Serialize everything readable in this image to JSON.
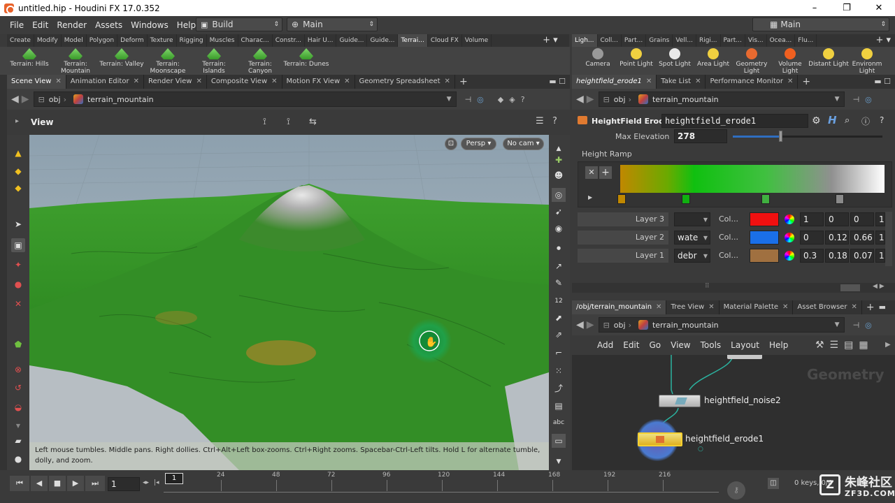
{
  "title": "untitled.hip - Houdini FX 17.0.352",
  "window_controls": [
    "–",
    "❐",
    "✕"
  ],
  "menu": [
    "File",
    "Edit",
    "Render",
    "Assets",
    "Windows",
    "Help"
  ],
  "desktop": {
    "build": "Build",
    "main": "Main",
    "main_right": "Main"
  },
  "shelf_tabs_left": [
    "Create",
    "Modify",
    "Model",
    "Polygon",
    "Deform",
    "Texture",
    "Rigging",
    "Muscles",
    "Charac...",
    "Constr...",
    "Hair U...",
    "Guide...",
    "Guide...",
    "Terrai...",
    "Cloud FX",
    "Volume"
  ],
  "shelf_tabs_right": [
    "Ligh...",
    "Coll...",
    "Part...",
    "Grains",
    "Vell...",
    "Rigi...",
    "Part...",
    "Vis...",
    "Ocea...",
    "Flu..."
  ],
  "terrain_tools": [
    {
      "l1": "Terrain: Hills",
      "l2": ""
    },
    {
      "l1": "Terrain:",
      "l2": "Mountain"
    },
    {
      "l1": "Terrain: Valley",
      "l2": ""
    },
    {
      "l1": "Terrain:",
      "l2": "Moonscape"
    },
    {
      "l1": "Terrain:",
      "l2": "Islands"
    },
    {
      "l1": "Terrain:",
      "l2": "Canyon"
    },
    {
      "l1": "Terrain: Dunes",
      "l2": ""
    }
  ],
  "light_tools": [
    {
      "l1": "Camera",
      "l2": ""
    },
    {
      "l1": "Point Light",
      "l2": ""
    },
    {
      "l1": "Spot Light",
      "l2": ""
    },
    {
      "l1": "Area Light",
      "l2": ""
    },
    {
      "l1": "Geometry",
      "l2": "Light"
    },
    {
      "l1": "Volume Light",
      "l2": ""
    },
    {
      "l1": "Distant Light",
      "l2": ""
    },
    {
      "l1": "Environm",
      "l2": "Light"
    }
  ],
  "viewer_tabs": [
    "Scene View",
    "Animation Editor",
    "Render View",
    "Composite View",
    "Motion FX View",
    "Geometry Spreadsheet"
  ],
  "path": {
    "root": "obj",
    "node": "terrain_mountain"
  },
  "viewer": {
    "label": "View",
    "persp": "Persp ▾",
    "cam": "No cam ▾",
    "hint": "Left mouse tumbles. Middle pans. Right dollies. Ctrl+Alt+Left box-zooms. Ctrl+Right zooms. Spacebar-Ctrl-Left tilts. Hold L for alternate tumble, dolly, and zoom."
  },
  "param_tabs": [
    "heightfield_erode1",
    "Take List",
    "Performance Monitor"
  ],
  "params": {
    "node_type": "HeightField Erode",
    "node_name": "heightfield_erode1",
    "max_elevation_label": "Max Elevation",
    "max_elevation": "278",
    "max_elevation_fraction": 0.32,
    "height_ramp_label": "Height Ramp",
    "layers": [
      {
        "label": "Layer 3",
        "name": "",
        "col": "Col...",
        "color": "#f01010",
        "r": "1",
        "g": "0",
        "b": "0",
        "a": "1"
      },
      {
        "label": "Layer 2",
        "name": "wate",
        "col": "Col...",
        "color": "#1a6fe8",
        "r": "0",
        "g": "0.12",
        "b": "0.66",
        "a": "1"
      },
      {
        "label": "Layer 1",
        "name": "debr",
        "col": "Col...",
        "color": "#a07040",
        "r": "0.3",
        "g": "0.18",
        "b": "0.07",
        "a": "1"
      }
    ]
  },
  "network_tabs": [
    "/obj/terrain_mountain",
    "Tree View",
    "Material Palette",
    "Asset Browser"
  ],
  "network_menu": [
    "Add",
    "Edit",
    "Go",
    "View",
    "Tools",
    "Layout",
    "Help"
  ],
  "network": {
    "watermark": "Geometry",
    "node1": "heightfield_noise2",
    "node2": "heightfield_erode1"
  },
  "timeline": {
    "frame": "1",
    "ticks": [
      "24",
      "48",
      "72",
      "96",
      "120",
      "144",
      "168",
      "192",
      "216"
    ],
    "current": "1",
    "keys": "0 keys, 0/0"
  },
  "brand": {
    "cn": "朱峰社区",
    "url": "ZF3D.COM"
  }
}
